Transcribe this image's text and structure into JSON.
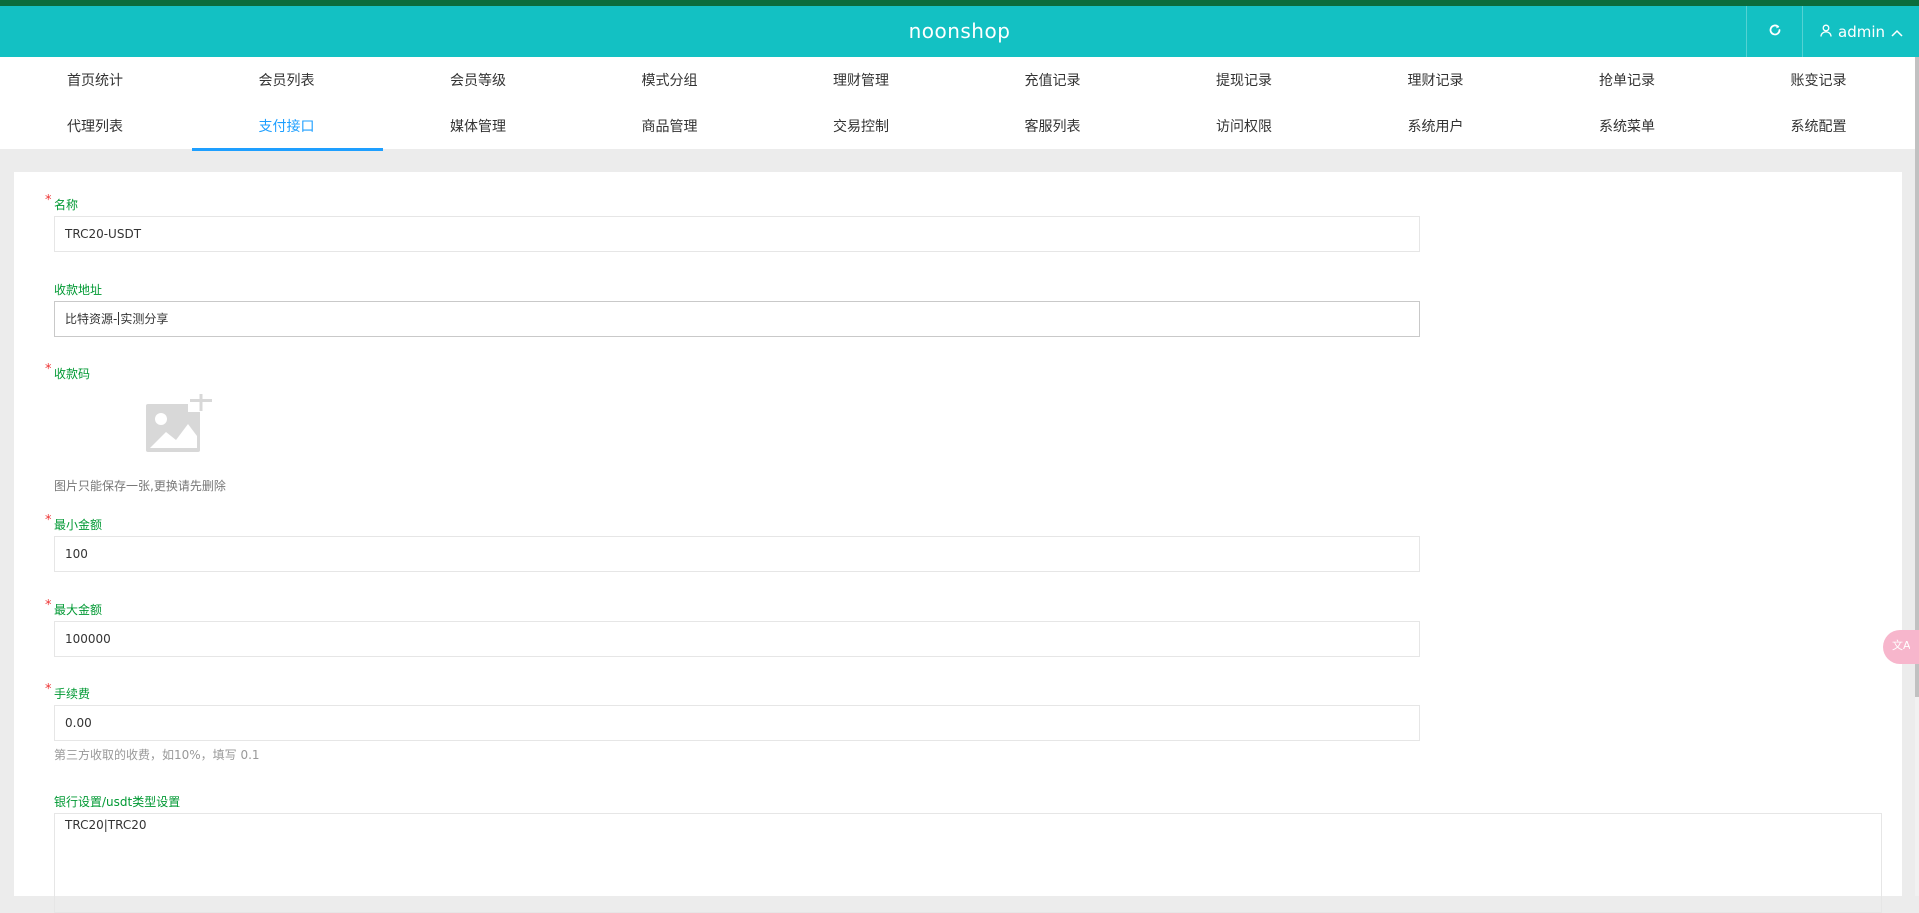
{
  "header": {
    "brand": "noonshop",
    "refresh_icon": "refresh-icon",
    "user": {
      "icon": "user-icon",
      "name": "admin",
      "chevron": "chevron-up-icon"
    },
    "bg_color": "#13c1c3",
    "strip_color": "#0b6d3c"
  },
  "nav": {
    "row1": [
      "首页统计",
      "会员列表",
      "会员等级",
      "模式分组",
      "理财管理",
      "充值记录",
      "提现记录",
      "理财记录",
      "抢单记录",
      "账变记录"
    ],
    "row2": [
      "代理列表",
      "支付接口",
      "媒体管理",
      "商品管理",
      "交易控制",
      "客服列表",
      "访问权限",
      "系统用户",
      "系统菜单",
      "系统配置"
    ],
    "active": "支付接口",
    "active_color": "#1e9fff"
  },
  "form": {
    "name": {
      "label": "名称",
      "required": true,
      "value": "TRC20-USDT"
    },
    "address": {
      "label": "收款地址",
      "required": false,
      "value_before_caret": "比特资源-",
      "value_after_caret": "实测分享"
    },
    "qrcode": {
      "label": "收款码",
      "required": true,
      "upload_icon": "image-upload-icon",
      "hint": "图片只能保存一张,更换请先删除"
    },
    "min_amount": {
      "label": "最小金额",
      "required": true,
      "value": "100"
    },
    "max_amount": {
      "label": "最大金额",
      "required": true,
      "value": "100000"
    },
    "fee": {
      "label": "手续费",
      "required": true,
      "value": "0.00",
      "hint": "第三方收取的收费，如10%，填写 0.1"
    },
    "bank_settings": {
      "label": "银行设置/usdt类型设置",
      "required": false,
      "value": "TRC20|TRC20"
    },
    "label_color": "#009933",
    "required_color": "#ee3333"
  },
  "float_button": {
    "icon": "translate-icon"
  }
}
